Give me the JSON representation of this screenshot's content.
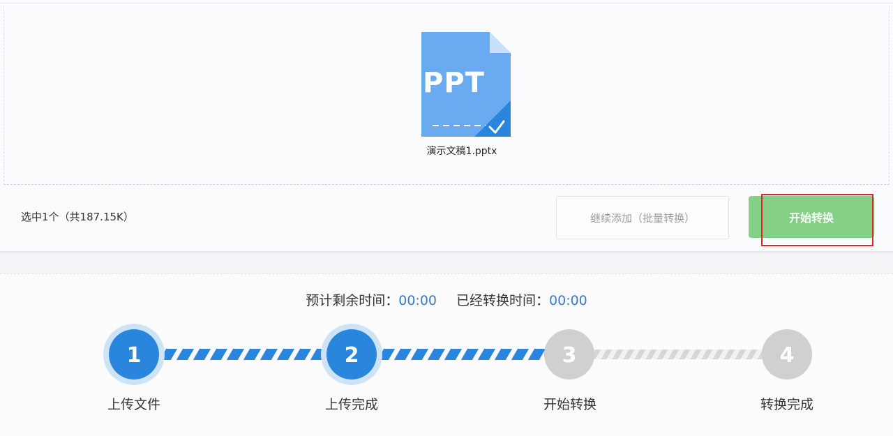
{
  "file": {
    "type_label": "PPT",
    "name": "演示文稿1.pptx",
    "icon": "ppt-file-checked-icon"
  },
  "toolbar": {
    "selection_summary": "选中1个（共187.15K）",
    "add_more_label": "继续添加（批量转换）",
    "start_label": "开始转换"
  },
  "timer": {
    "remaining_label": "预计剩余时间：",
    "remaining_value": "00:00",
    "elapsed_label": "已经转换时间：",
    "elapsed_value": "00:00"
  },
  "steps": [
    {
      "number": "1",
      "label": "上传文件",
      "status": "done"
    },
    {
      "number": "2",
      "label": "上传完成",
      "status": "done"
    },
    {
      "number": "3",
      "label": "开始转换",
      "status": "pending"
    },
    {
      "number": "4",
      "label": "转换完成",
      "status": "pending"
    }
  ],
  "colors": {
    "active": "#2a85dd",
    "inactive": "#d0d0d0",
    "start_button": "#86cf86",
    "highlight": "#d62a2a"
  }
}
